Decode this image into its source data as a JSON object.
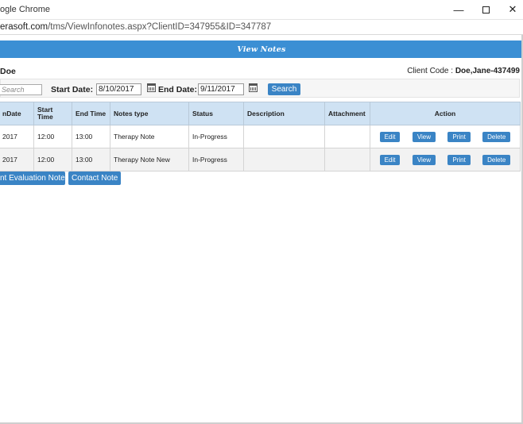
{
  "window": {
    "title": "ogle Chrome",
    "min_glyph": "—",
    "close_glyph": "✕"
  },
  "address_bar": {
    "host": "erasoft.com",
    "path": "/tms/ViewInfonotes.aspx?ClientID=347955&ID=347787"
  },
  "header": {
    "title": "View Notes"
  },
  "client": {
    "name": "Doe",
    "code_label": "Client Code :",
    "code_value": "Doe,Jane-437499"
  },
  "filters": {
    "search_placeholder": "Search",
    "start_label": "Start Date:",
    "start_value": "8/10/2017",
    "end_label": "End Date:",
    "end_value": "9/11/2017",
    "search_button": "Search"
  },
  "table": {
    "columns": [
      "nDate",
      "Start Time",
      "End Time",
      "Notes type",
      "Status",
      "Description",
      "Attachment",
      "Action"
    ],
    "rows": [
      {
        "date": "2017",
        "start": "12:00",
        "end": "13:00",
        "type": "Therapy Note",
        "status": "In-Progress",
        "description": "",
        "attachment": ""
      },
      {
        "date": "2017",
        "start": "12:00",
        "end": "13:00",
        "type": "Therapy Note New",
        "status": "In-Progress",
        "description": "",
        "attachment": ""
      }
    ],
    "action_labels": {
      "edit": "Edit",
      "view": "View",
      "print": "Print",
      "delete": "Delete"
    }
  },
  "add_buttons": {
    "evaluation": "nt Evaluation Note",
    "contact": "Contact Note"
  },
  "colors": {
    "accent": "#3b8fd4",
    "button": "#3a84c5",
    "table_header": "#cfe2f3"
  },
  "icons": [
    "calendar-icon",
    "minimize-icon",
    "maximize-icon",
    "close-icon"
  ]
}
